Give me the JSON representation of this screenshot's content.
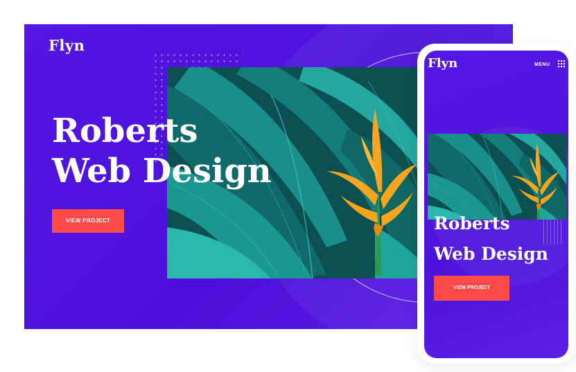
{
  "desktop": {
    "logo": "Flyn",
    "title_line1": "Roberts",
    "title_line2": "Web Design",
    "button_label": "VIEW PROJECT"
  },
  "mobile": {
    "logo": "Flyn",
    "menu_label": "MENU",
    "title_line1": "Roberts",
    "title_line2": "Web Design",
    "button_label": "VIEW PROJECT"
  },
  "colors": {
    "background_purple": "#5416e3",
    "button_red": "#ff4a4a",
    "leaf_teal": "#1aa39c",
    "flower_orange": "#f6a21e"
  },
  "icons": {
    "menu": "grid-dots-icon"
  }
}
